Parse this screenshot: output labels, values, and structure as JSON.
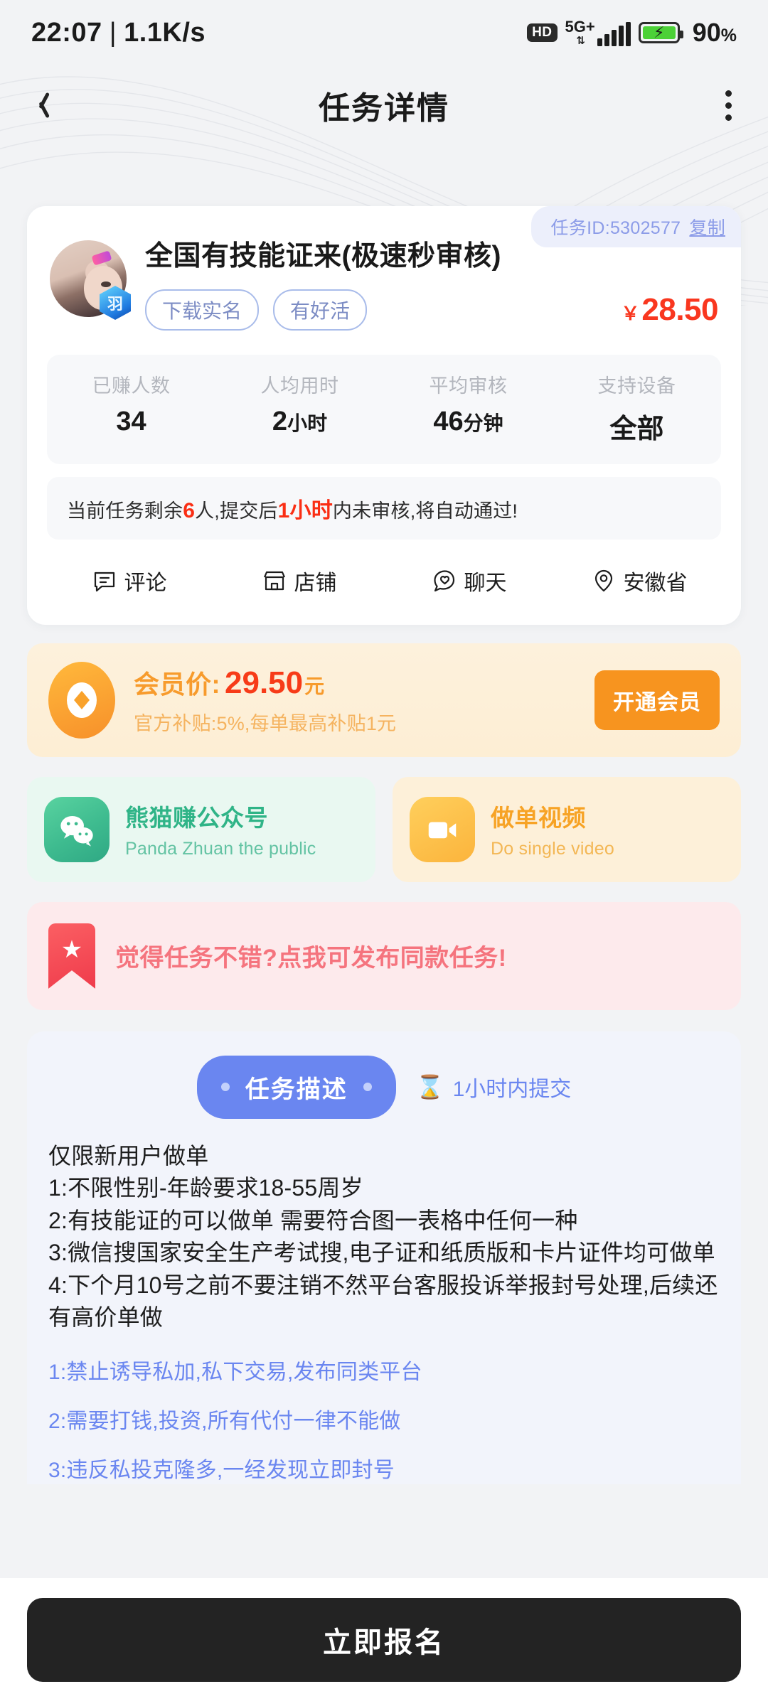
{
  "status_bar": {
    "time": "22:07",
    "divider": "|",
    "net_speed": "1.1K/s",
    "hd_label": "HD",
    "network_type": "5G+",
    "network_arrows": "⇅",
    "battery_percent": "90",
    "battery_percent_symbol": "%",
    "icons": [
      "hd-badge-icon",
      "network-5g-icon",
      "signal-bars-icon",
      "battery-charging-icon"
    ]
  },
  "header": {
    "title": "任务详情",
    "back_icon": "chevron-left-icon",
    "more_icon": "more-vertical-icon"
  },
  "task_card": {
    "id_label": "任务ID:5302577",
    "copy_label": "复制",
    "title": "全国有技能证来(极速秒审核)",
    "avatar_badge": "羽",
    "tags": [
      "下载实名",
      "有好活"
    ],
    "price_currency": "￥",
    "price_amount": "28.50",
    "stats": [
      {
        "key": "已赚人数",
        "value": "34",
        "unit": ""
      },
      {
        "key": "人均用时",
        "value": "2",
        "unit": "小时"
      },
      {
        "key": "平均审核",
        "value": "46",
        "unit": "分钟"
      },
      {
        "key": "支持设备",
        "value": "全部",
        "unit": ""
      }
    ],
    "notice": {
      "part1": "当前任务剩余",
      "highlight1": "6",
      "part2": "人,提交后",
      "highlight2": "1小时",
      "part3": "内未审核,将自动通过!"
    },
    "actions": [
      {
        "label": "评论",
        "icon": "comment-icon"
      },
      {
        "label": "店铺",
        "icon": "shop-icon"
      },
      {
        "label": "聊天",
        "icon": "chat-heart-icon"
      },
      {
        "label": "安徽省",
        "icon": "location-pin-icon"
      }
    ]
  },
  "vip_banner": {
    "icon": "coin-icon",
    "price_label": "会员价:",
    "price_value": "29.50",
    "price_unit": "元",
    "subsidy_text": "官方补贴:5%,每单最高补贴1元",
    "button_label": "开通会员"
  },
  "promos": [
    {
      "icon": "wechat-icon",
      "title": "熊猫赚公众号",
      "subtitle": "Panda Zhuan the public",
      "accent": "#2fb487"
    },
    {
      "icon": "video-camera-icon",
      "title": "做单视频",
      "subtitle": "Do single video",
      "accent": "#f7a325"
    }
  ],
  "publish_banner": {
    "icon": "bookmark-star-icon",
    "text": "觉得任务不错?点我可发布同款任务!",
    "accent": "#f5747e"
  },
  "description": {
    "tab_label": "任务描述",
    "deadline_icon": "hourglass-icon",
    "deadline_label": "1小时内提交",
    "lines": [
      "仅限新用户做单",
      "1:不限性别-年龄要求18-55周岁",
      "2:有技能证的可以做单 需要符合图一表格中任何一种",
      "3:微信搜国家安全生产考试搜,电子证和纸质版和卡片证件均可做单",
      "4:下个月10号之前不要注销不然平台客服投诉举报封号处理,后续还有高价单做"
    ],
    "rules": [
      "1:禁止诱导私加,私下交易,发布同类平台",
      "2:需要打钱,投资,所有代付一律不能做",
      "3:违反私投克隆多,一经发现立即封号"
    ]
  },
  "cta": {
    "label": "立即报名"
  },
  "colors": {
    "accent_blue": "#6a86f0",
    "price_red": "#f9371f",
    "vip_orange": "#f7941f",
    "green": "#2fb487",
    "pink": "#f5747e",
    "cta_dark": "#232323"
  }
}
